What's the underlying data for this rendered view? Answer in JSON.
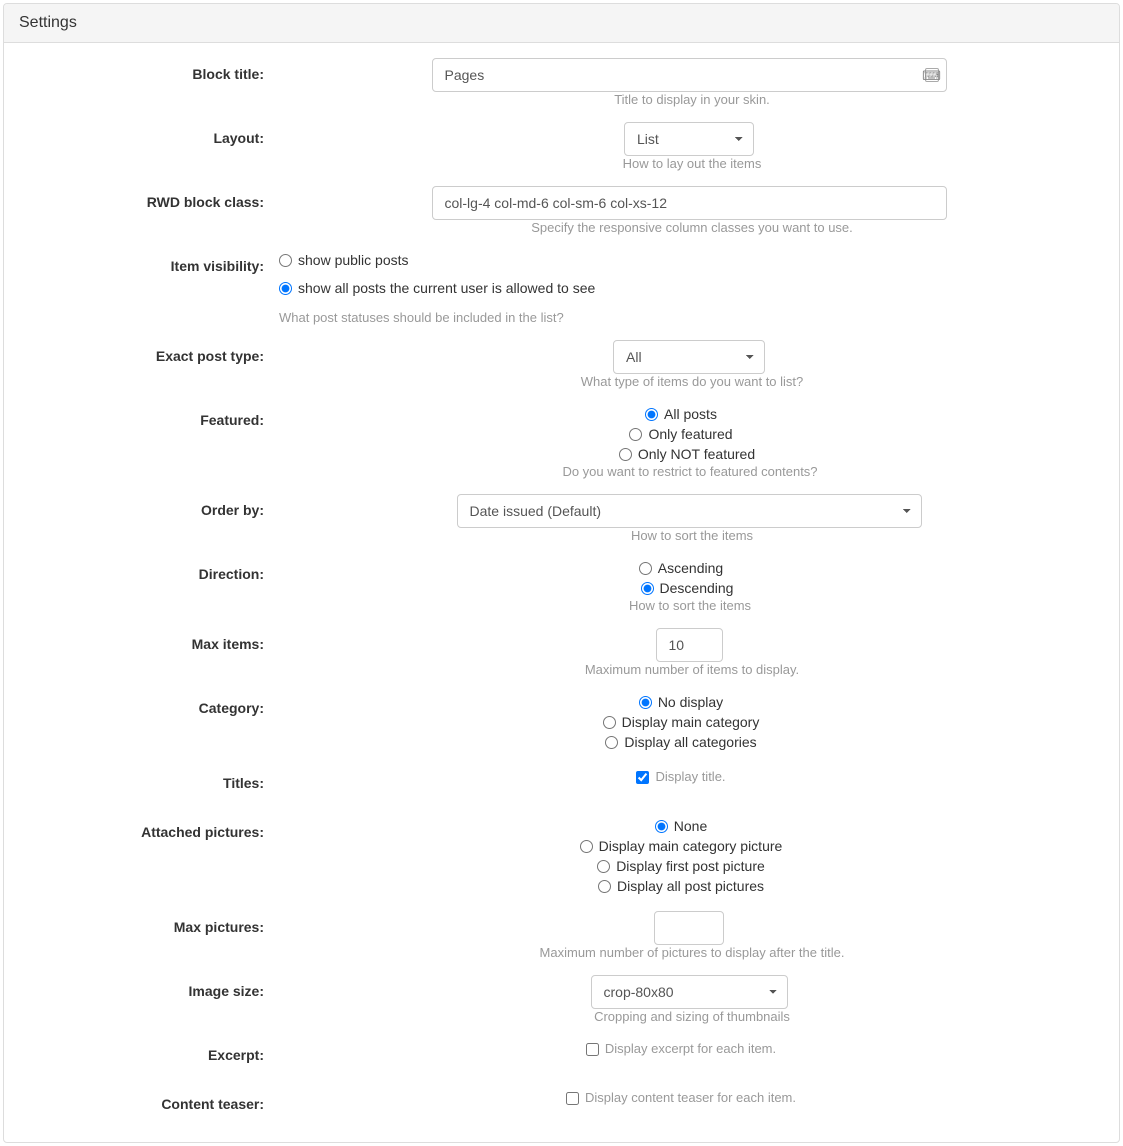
{
  "panel": {
    "title": "Settings"
  },
  "fields": {
    "block_title": {
      "label": "Block title:",
      "value": "Pages",
      "help": "Title to display in your skin."
    },
    "layout": {
      "label": "Layout:",
      "value": "List",
      "help": "How to lay out the items"
    },
    "rwd": {
      "label": "RWD block class:",
      "value": "col-lg-4 col-md-6 col-sm-6 col-xs-12",
      "help": "Specify the responsive column classes you want to use."
    },
    "visibility": {
      "label": "Item visibility:",
      "opt1": "show public posts",
      "opt2": "show all posts the current user is allowed to see",
      "help": "What post statuses should be included in the list?"
    },
    "posttype": {
      "label": "Exact post type:",
      "value": "All",
      "help": "What type of items do you want to list?"
    },
    "featured": {
      "label": "Featured:",
      "opt1": "All posts",
      "opt2": "Only featured",
      "opt3": "Only NOT featured",
      "help": "Do you want to restrict to featured contents?"
    },
    "orderby": {
      "label": "Order by:",
      "value": "Date issued (Default)",
      "help": "How to sort the items"
    },
    "direction": {
      "label": "Direction:",
      "opt1": "Ascending",
      "opt2": "Descending",
      "help": "How to sort the items"
    },
    "maxitems": {
      "label": "Max items:",
      "value": "10",
      "help": "Maximum number of items to display."
    },
    "category": {
      "label": "Category:",
      "opt1": "No display",
      "opt2": "Display main category",
      "opt3": "Display all categories"
    },
    "titles": {
      "label": "Titles:",
      "opt1": "Display title."
    },
    "pictures": {
      "label": "Attached pictures:",
      "opt1": "None",
      "opt2": "Display main category picture",
      "opt3": "Display first post picture",
      "opt4": "Display all post pictures"
    },
    "maxpics": {
      "label": "Max pictures:",
      "value": "",
      "help": "Maximum number of pictures to display after the title."
    },
    "imgsize": {
      "label": "Image size:",
      "value": "crop-80x80",
      "help": "Cropping and sizing of thumbnails"
    },
    "excerpt": {
      "label": "Excerpt:",
      "opt1": "Display excerpt for each item."
    },
    "teaser": {
      "label": "Content teaser:",
      "opt1": "Display content teaser for each item."
    }
  }
}
